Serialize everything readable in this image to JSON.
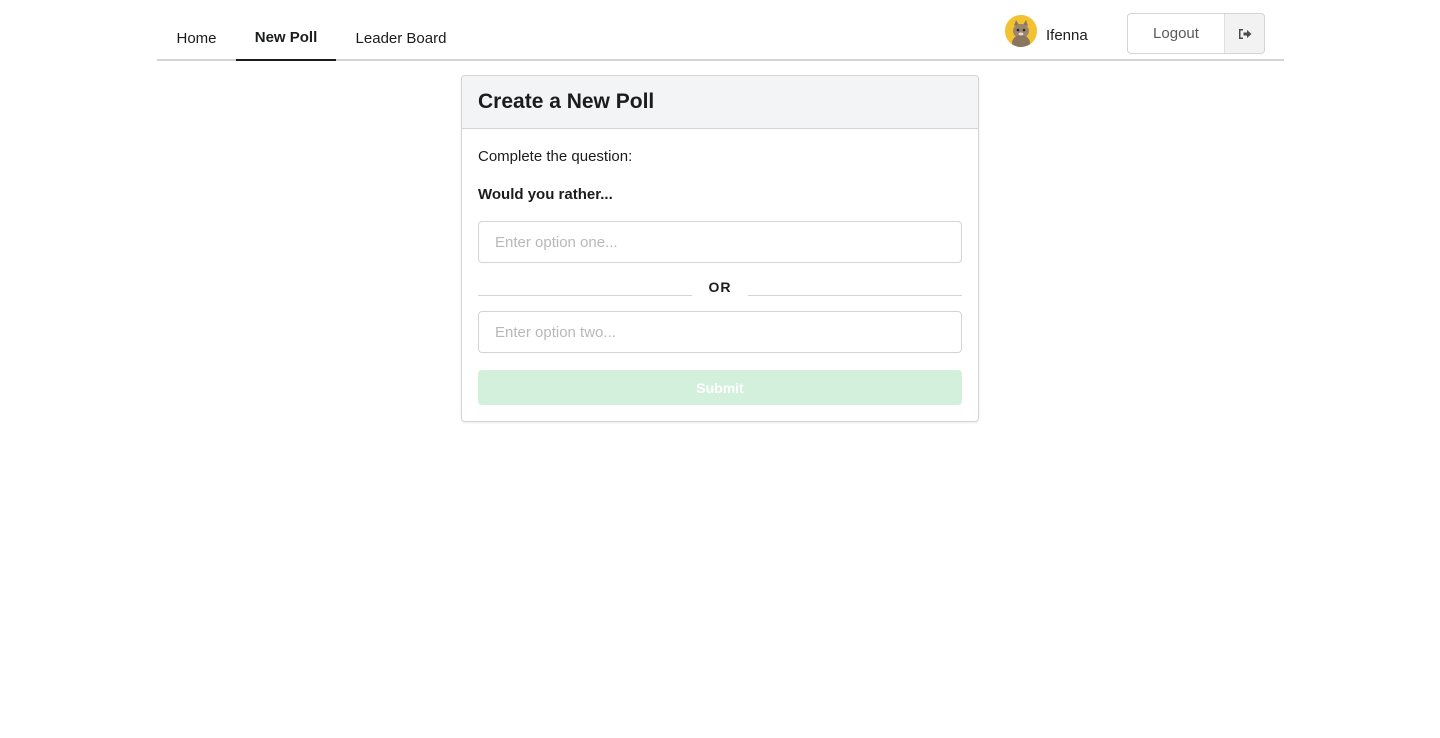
{
  "nav": {
    "items": [
      {
        "label": "Home"
      },
      {
        "label": "New Poll",
        "active": true
      },
      {
        "label": "Leader Board"
      }
    ]
  },
  "user": {
    "name": "Ifenna",
    "avatar_icon": "cat-avatar-icon"
  },
  "logout": {
    "label": "Logout",
    "icon": "sign-out-icon"
  },
  "card": {
    "title": "Create a New Poll",
    "prompt": "Complete the question:",
    "question": "Would you rather...",
    "option_one": {
      "value": "",
      "placeholder": "Enter option one..."
    },
    "divider": "OR",
    "option_two": {
      "value": "",
      "placeholder": "Enter option two..."
    },
    "submit_label": "Submit",
    "submit_disabled": true
  },
  "colors": {
    "submit_bg": "#d3f0dc",
    "header_bg": "#f3f4f5",
    "avatar_bg": "#f3c230"
  }
}
